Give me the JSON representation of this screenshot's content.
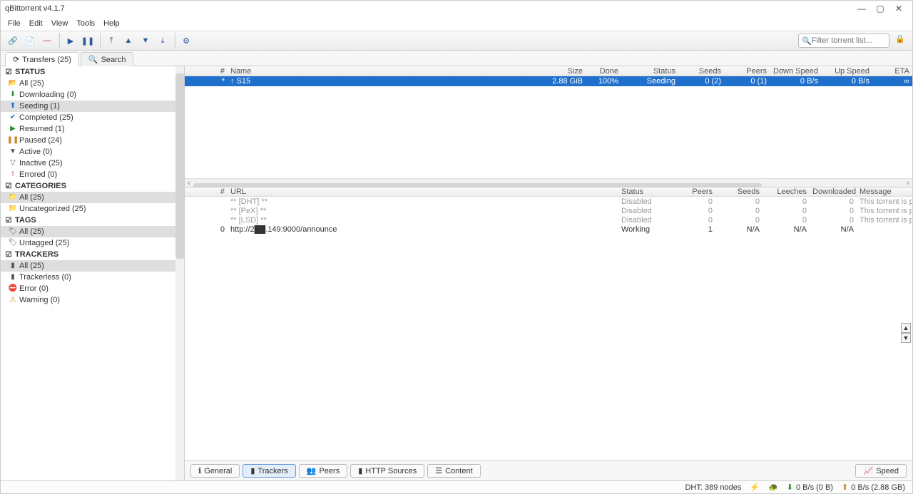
{
  "window": {
    "title": "qBittorrent v4.1.7"
  },
  "menu": [
    "File",
    "Edit",
    "View",
    "Tools",
    "Help"
  ],
  "filter_placeholder": "Filter torrent list...",
  "primary_tabs": {
    "transfers": "Transfers (25)",
    "search": "Search"
  },
  "sidebar": {
    "status": {
      "header": "STATUS",
      "items": [
        {
          "icon": "all",
          "label": "All (25)",
          "sel": false
        },
        {
          "icon": "down",
          "label": "Downloading (0)",
          "sel": false
        },
        {
          "icon": "seed",
          "label": "Seeding (1)",
          "sel": true
        },
        {
          "icon": "done",
          "label": "Completed (25)",
          "sel": false
        },
        {
          "icon": "resume",
          "label": "Resumed (1)",
          "sel": false
        },
        {
          "icon": "pause",
          "label": "Paused (24)",
          "sel": false
        },
        {
          "icon": "active",
          "label": "Active (0)",
          "sel": false
        },
        {
          "icon": "inactive",
          "label": "Inactive (25)",
          "sel": false
        },
        {
          "icon": "error",
          "label": "Errored (0)",
          "sel": false
        }
      ]
    },
    "categories": {
      "header": "CATEGORIES",
      "items": [
        {
          "icon": "folder",
          "label": "All (25)",
          "sel": true
        },
        {
          "icon": "folder",
          "label": "Uncategorized (25)",
          "sel": false
        }
      ]
    },
    "tags": {
      "header": "TAGS",
      "items": [
        {
          "icon": "tag",
          "label": "All (25)",
          "sel": true
        },
        {
          "icon": "tag",
          "label": "Untagged (25)",
          "sel": false
        }
      ]
    },
    "trackers": {
      "header": "TRACKERS",
      "items": [
        {
          "icon": "tracker",
          "label": "All (25)",
          "sel": true
        },
        {
          "icon": "tracker",
          "label": "Trackerless (0)",
          "sel": false
        },
        {
          "icon": "terror",
          "label": "Error (0)",
          "sel": false
        },
        {
          "icon": "twarn",
          "label": "Warning (0)",
          "sel": false
        }
      ]
    }
  },
  "columns": {
    "num": "#",
    "name": "Name",
    "size": "Size",
    "done": "Done",
    "status": "Status",
    "seeds": "Seeds",
    "peers": "Peers",
    "down": "Down Speed",
    "up": "Up Speed",
    "eta": "ETA"
  },
  "torrent_row": {
    "num": "*",
    "name": "S15",
    "size": "2.88 GiB",
    "done": "100%",
    "status": "Seeding",
    "seeds": "0 (2)",
    "peers": "0 (1)",
    "down": "0 B/s",
    "up": "0 B/s",
    "eta": "∞"
  },
  "tracker_cols": {
    "num": "#",
    "url": "URL",
    "status": "Status",
    "peers": "Peers",
    "seeds": "Seeds",
    "leeches": "Leeches",
    "downloaded": "Downloaded",
    "message": "Message"
  },
  "tracker_rows": [
    {
      "num": "",
      "url": "** [DHT] **",
      "status": "Disabled",
      "peers": "0",
      "seeds": "0",
      "leeches": "0",
      "down": "0",
      "msg": "This torrent is p...",
      "dim": true
    },
    {
      "num": "",
      "url": "** [PeX] **",
      "status": "Disabled",
      "peers": "0",
      "seeds": "0",
      "leeches": "0",
      "down": "0",
      "msg": "This torrent is p...",
      "dim": true
    },
    {
      "num": "",
      "url": "** [LSD] **",
      "status": "Disabled",
      "peers": "0",
      "seeds": "0",
      "leeches": "0",
      "down": "0",
      "msg": "This torrent is p...",
      "dim": true
    },
    {
      "num": "0",
      "url": "http://2██.149:9000/announce",
      "status": "Working",
      "peers": "1",
      "seeds": "N/A",
      "leeches": "N/A",
      "down": "N/A",
      "msg": "",
      "dim": false
    }
  ],
  "detail_tabs": {
    "general": "General",
    "trackers": "Trackers",
    "peers": "Peers",
    "http": "HTTP Sources",
    "content": "Content",
    "speed": "Speed"
  },
  "status_bar": {
    "dht": "DHT: 389 nodes",
    "down": "0 B/s (0 B)",
    "up": "0 B/s (2.88 GB)"
  }
}
